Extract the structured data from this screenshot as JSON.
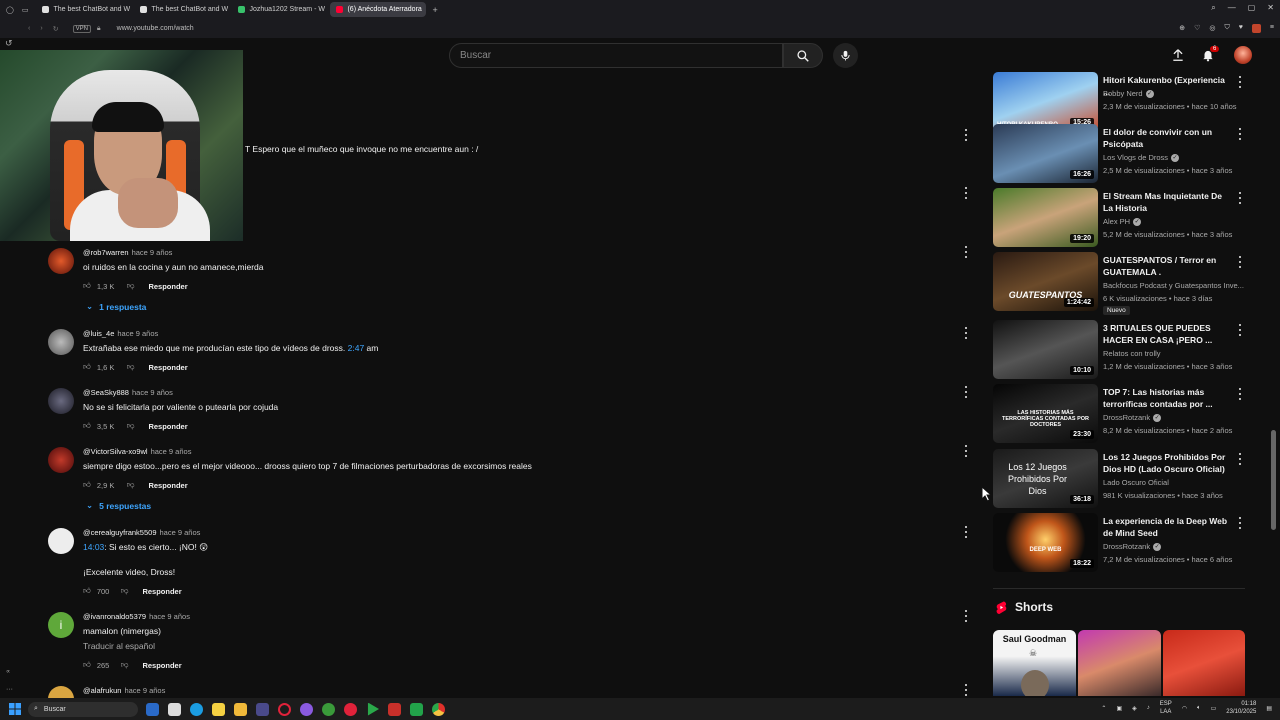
{
  "browser": {
    "tabs": [
      {
        "label": "The best ChatBot and W",
        "color": "#e0e0e0"
      },
      {
        "label": "The best ChatBot and W",
        "color": "#e0e0e0"
      },
      {
        "label": "Jozhua1202 Stream - W",
        "color": "#38c26b"
      },
      {
        "label": "(6) Anécdota Aterradora",
        "color": "#ff0033",
        "active": true
      }
    ],
    "new_tab": "+",
    "vpn": "VPN",
    "url": "www.youtube.com/watch"
  },
  "header": {
    "search_placeholder": "Buscar",
    "notifications_count": "6"
  },
  "cut_comment": "T Espero que el muñeco que invoque no me encuentre aun : /",
  "comments": [
    {
      "author": "@rob7warren",
      "time": "hace 9 años",
      "text": "oi ruidos en la cocina y aun no amanece,mierda",
      "likes": "1,3 K",
      "reply": "Responder",
      "replies": "1 respuesta",
      "avatar": "#b2361e"
    },
    {
      "author": "@luis_4e",
      "time": "hace 9 años",
      "text": "Extrañaba ese miedo que me producían este tipo de vídeos de dross.",
      "ts": "2:47",
      "text_after": " am",
      "likes": "1,6 K",
      "reply": "Responder",
      "avatar": "#8c8c8c"
    },
    {
      "author": "@SeaSky888",
      "time": "hace 9 años",
      "text": "No se si felicitarla por valiente o putearla por cojuda",
      "likes": "3,5 K",
      "reply": "Responder",
      "avatar": "#3a3a4a"
    },
    {
      "author": "@VictorSilva-xo9wl",
      "time": "hace 9 años",
      "text": "siempre digo estoo...pero es el mejor videooo... drooss quiero top 7 de  filmaciones perturbadoras de excorsimos reales",
      "likes": "2,9 K",
      "reply": "Responder",
      "replies": "5 respuestas",
      "avatar": "#8a1a1a"
    },
    {
      "author": "@cerealguyfrank5509",
      "time": "hace 9 años",
      "ts": "14:03",
      "text": ": Si esto es cierto... ¡NO! 😲",
      "text2": "¡Excelente video, Dross!",
      "likes": "700",
      "reply": "Responder",
      "avatar": "#ededed"
    },
    {
      "author": "@ivanronaldo5379",
      "time": "hace 9 años",
      "text": "mamalon (nimergas)",
      "translate": "Traducir al español",
      "likes": "265",
      "reply": "Responder",
      "avatar": "#5fa83a",
      "initial": "i"
    },
    {
      "author": "@alafrukun",
      "time": "hace 9 años",
      "avatar": "#d9a541"
    }
  ],
  "videos": [
    {
      "title": "Hitori Kakurenbo (Experiencia ...",
      "channel": "Bobby Nerd",
      "verified": true,
      "meta": "2,3 M de visualizaciones • hace 10 años",
      "duration": "15:26",
      "thumb_text": "HITORI KAKURENBO",
      "bg": "linear-gradient(160deg,#3a7bd5,#9fd1f0 50%,#c94b2a)"
    },
    {
      "title": "El dolor de convivir con un Psicópata",
      "channel": "Los Vlogs de Dross",
      "verified": true,
      "meta": "2,5 M de visualizaciones • hace 3 años",
      "duration": "16:26",
      "thumb_text": "",
      "bg": "linear-gradient(160deg,#2b3b55,#6a8fb3 55%,#1b2533)"
    },
    {
      "title": "El Stream Mas Inquietante De La Historia",
      "channel": "Alex PH",
      "verified": true,
      "meta": "5,2 M de visualizaciones • hace 3 años",
      "duration": "19:20",
      "thumb_text": "",
      "bg": "linear-gradient(160deg,#4a7a2a,#c9a37a 50%,#3a5a20)"
    },
    {
      "title": "GUATESPANTOS / Terror en GUATEMALA .",
      "channel": "Backfocus Podcast y Guatespantos Inve...",
      "verified": false,
      "meta": "6 K visualizaciones • hace 3 días",
      "badge": "Nuevo",
      "duration": "1:24:42",
      "thumb_text": "GUATESPANTOS",
      "bg": "linear-gradient(160deg,#2a1a12,#6b4a2a 50%,#1a120a)"
    },
    {
      "title": "3 RITUALES  QUE PUEDES HACER EN CASA ¡PERO ...",
      "channel": "Relatos con trolly",
      "verified": false,
      "meta": "1,2 M de visualizaciones • hace 3 años",
      "duration": "10:10",
      "thumb_text": "",
      "bg": "linear-gradient(160deg,#111,#555 50%,#1a1a1a)"
    },
    {
      "title": "TOP 7:  Las historias más terroríficas contadas por ...",
      "channel": "DrossRotzank",
      "verified": true,
      "meta": "8,2 M de visualizaciones • hace 2 años",
      "duration": "23:30",
      "thumb_text": "LAS HISTORIAS MÁS TERRORÍFICAS CONTADAS POR DOCTORES",
      "bg": "linear-gradient(160deg,#050505,#2a2a2a 50%,#0a0a0a)"
    },
    {
      "title": "Los 12 Juegos Prohibidos Por Dios HD (Lado Oscuro Oficial)",
      "channel": "Lado Oscuro Oficial",
      "verified": false,
      "meta": "981 K visualizaciones • hace 3 años",
      "duration": "36:18",
      "thumb_text": "Los 12 Juegos Prohibidos Por Dios",
      "bg": "linear-gradient(160deg,#1a1a1a,#3a3a3a 50%,#111)"
    },
    {
      "title": "La experiencia de la Deep Web de Mind Seed",
      "channel": "DrossRotzank",
      "verified": true,
      "meta": "7,2 M de visualizaciones • hace 6 años",
      "duration": "18:22",
      "thumb_text": "DEEP WEB",
      "bg": "radial-gradient(circle at 50% 45%,#ffcf6a,#c0561a 30%,#0a0a0a 65%)"
    }
  ],
  "shorts": {
    "label": "Shorts",
    "items": [
      {
        "text": "Saul Goodman",
        "bg": "linear-gradient(180deg,#f4f4f4 0%,#f4f4f4 40%,#1a2a4a 100%)"
      },
      {
        "text": "",
        "bg": "linear-gradient(160deg,#c23ab0,#d98a6a 50%,#3a2a2a)"
      },
      {
        "text": "",
        "bg": "linear-gradient(160deg,#c82a1a,#e8503a 50%,#8a1a10)"
      }
    ]
  },
  "taskbar": {
    "search": "Buscar",
    "lang_1": "ESP",
    "lang_2": "LAA",
    "time": "01:18",
    "date": "23/10/2025"
  }
}
